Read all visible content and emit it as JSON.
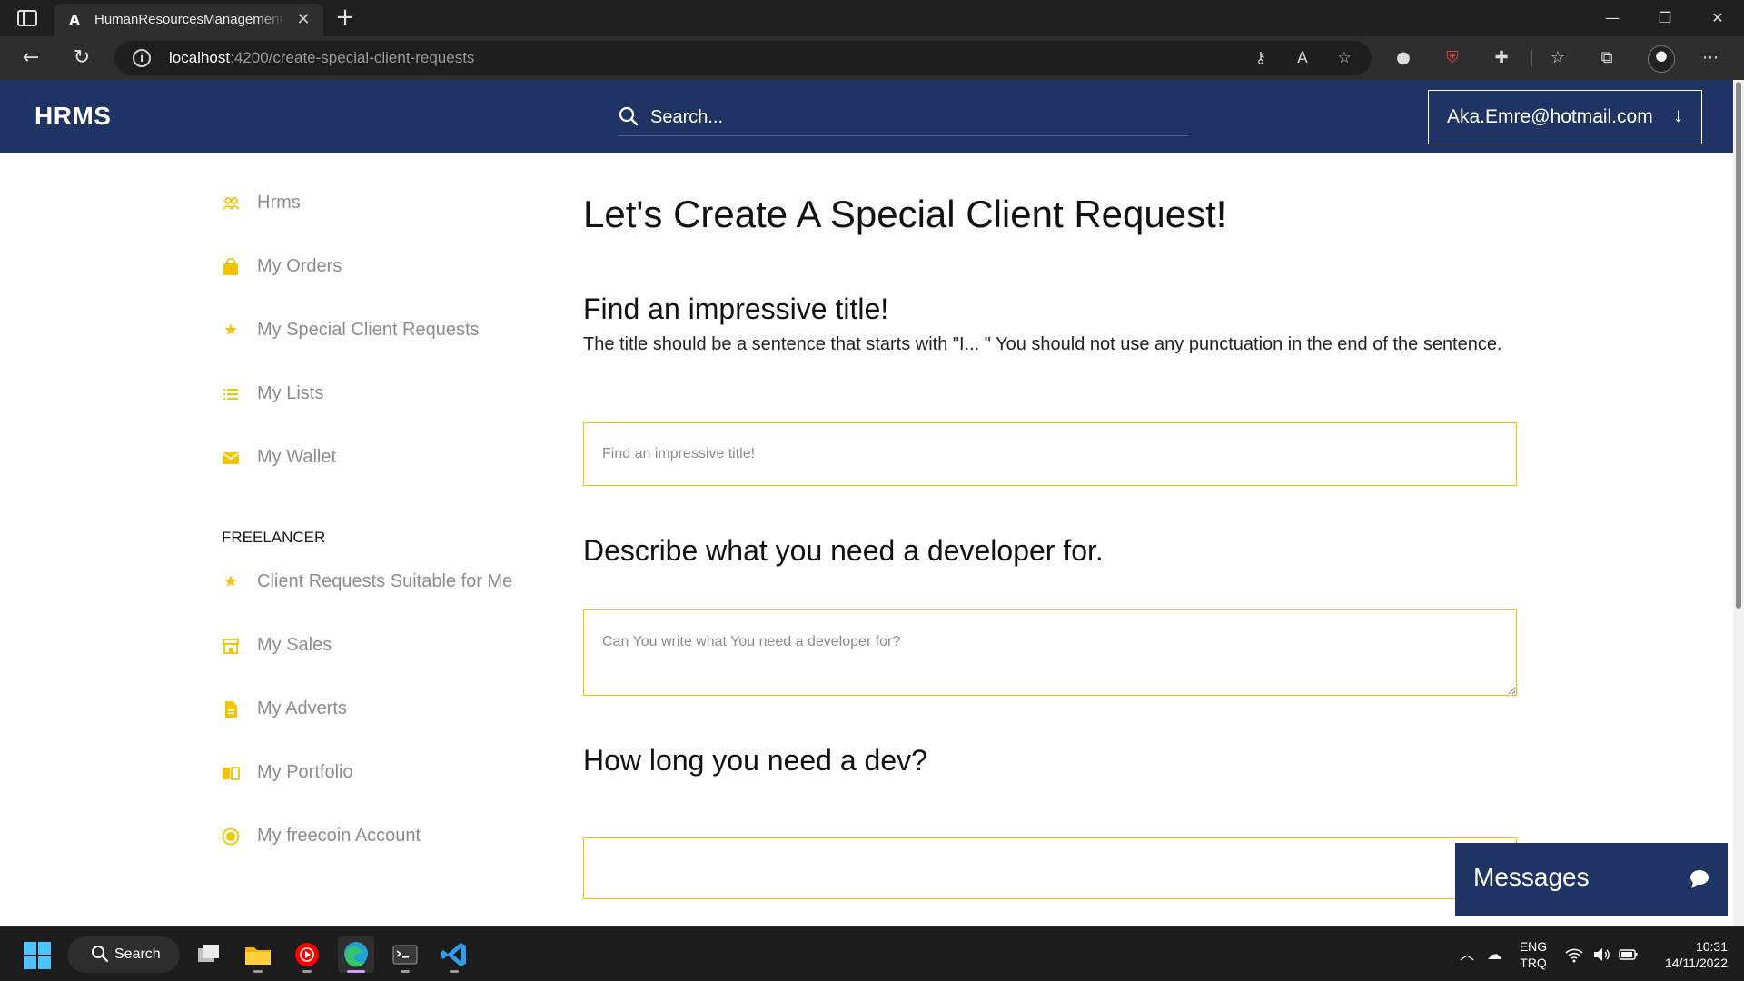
{
  "browser": {
    "tab_favicon": "A",
    "tab_title": "HumanResourcesManagementSystem",
    "url_host": "localhost",
    "url_path": ":4200/create-special-client-requests",
    "icons": [
      "sidebar-toggle-icon",
      "close-icon",
      "plus-icon",
      "minimize-icon",
      "restore-icon",
      "window-close-icon",
      "back-icon",
      "refresh-icon",
      "info-icon",
      "key-icon",
      "read-aloud-icon",
      "add-favorite-icon",
      "extension-icon",
      "shield-extension-icon",
      "puzzle-icon",
      "favorites-icon",
      "collections-icon",
      "profile-avatar",
      "more-icon"
    ]
  },
  "header": {
    "brand": "HRMS",
    "search_placeholder": "Search...",
    "user_email": "Aka.Emre@hotmail.com",
    "user_arrow": "↓",
    "colors": {
      "header_bg": "#1f3464",
      "accent": "#f0c400"
    }
  },
  "sidebar": {
    "items": [
      {
        "label": "Hrms",
        "icon": "users-icon"
      },
      {
        "label": "My Orders",
        "icon": "shopping-bag-icon"
      },
      {
        "label": "My Special Client Requests",
        "icon": "star-icon"
      },
      {
        "label": "My Lists",
        "icon": "list-icon"
      },
      {
        "label": "My Wallet",
        "icon": "envelope-icon"
      }
    ],
    "freelancer_heading": "FREELANCER",
    "freelancer_items": [
      {
        "label": "Client Requests Suitable for Me",
        "icon": "star-icon"
      },
      {
        "label": "My Sales",
        "icon": "store-icon"
      },
      {
        "label": "My Adverts",
        "icon": "file-icon"
      },
      {
        "label": "My Portfolio",
        "icon": "book-icon"
      },
      {
        "label": "My freecoin Account",
        "icon": "coin-icon"
      }
    ]
  },
  "main": {
    "page_title": "Let's Create A Special Client Request!",
    "title_section": {
      "heading": "Find an impressive title!",
      "description": "The title should be a sentence that starts with \"I... \" You should not use any punctuation in the end of the sentence.",
      "placeholder": "Find an impressive title!"
    },
    "describe_section": {
      "heading": "Describe what you need a developer for.",
      "placeholder": "Can You write what You need a developer for?"
    },
    "duration_section": {
      "heading": "How long you need a dev?",
      "value": ""
    }
  },
  "messages_widget": {
    "label": "Messages",
    "icon": "chat-bubble-icon"
  },
  "taskbar": {
    "search_label": "Search",
    "lang_top": "ENG",
    "lang_bottom": "TRQ",
    "time": "10:31",
    "date": "14/11/2022",
    "apps": [
      "windows-start-icon",
      "task-view-icon",
      "file-explorer-icon",
      "youtube-music-icon",
      "edge-icon",
      "terminal-icon",
      "vscode-icon"
    ]
  }
}
